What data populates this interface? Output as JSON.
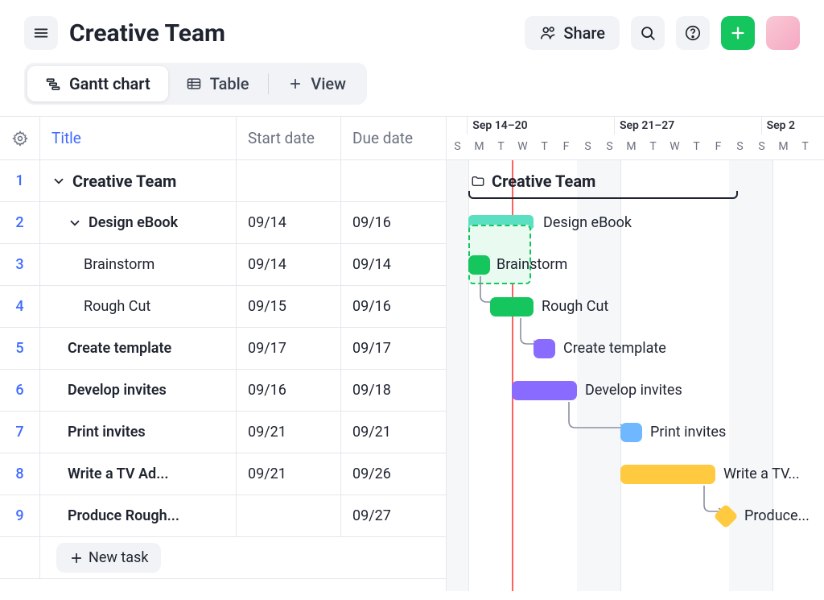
{
  "header": {
    "page_title": "Creative Team",
    "share_label": "Share"
  },
  "tabs": {
    "gantt_label": "Gantt chart",
    "table_label": "Table",
    "view_label": "View"
  },
  "columns": {
    "title": "Title",
    "start": "Start date",
    "due": "Due date"
  },
  "new_task_label": "New task",
  "weeks": [
    {
      "label": "Sep 14–20"
    },
    {
      "label": "Sep 21–27"
    },
    {
      "label": "Sep 2"
    }
  ],
  "day_letters": [
    "S",
    "M",
    "T",
    "W",
    "T",
    "F",
    "S",
    "S",
    "M",
    "T",
    "W",
    "T",
    "F",
    "S",
    "S",
    "M",
    "T"
  ],
  "group_label": "Creative Team",
  "rows": [
    {
      "num": "1",
      "title": "Creative Team",
      "start": "",
      "due": "",
      "indent": 0,
      "chevron": true
    },
    {
      "num": "2",
      "title": "Design eBook",
      "start": "09/14",
      "due": "09/16",
      "indent": 1,
      "chevron": true
    },
    {
      "num": "3",
      "title": "Brainstorm",
      "start": "09/14",
      "due": "09/14",
      "indent": 2
    },
    {
      "num": "4",
      "title": "Rough Cut",
      "start": "09/15",
      "due": "09/16",
      "indent": 2
    },
    {
      "num": "5",
      "title": "Create template",
      "start": "09/17",
      "due": "09/17",
      "indent": 1
    },
    {
      "num": "6",
      "title": "Develop invites",
      "start": "09/16",
      "due": "09/18",
      "indent": 1
    },
    {
      "num": "7",
      "title": "Print invites",
      "start": "09/21",
      "due": "09/21",
      "indent": 1
    },
    {
      "num": "8",
      "title": "Write a TV Ad...",
      "start": "09/21",
      "due": "09/26",
      "indent": 1
    },
    {
      "num": "9",
      "title": "Produce Rough...",
      "start": "",
      "due": "09/27",
      "indent": 1
    }
  ],
  "gantt": {
    "bars": {
      "design_ebook": "Design eBook",
      "brainstorm": "Brainstorm",
      "rough_cut": "Rough Cut",
      "create_template": "Create template",
      "develop_invites": "Develop invites",
      "print_invites": "Print invites",
      "write_tv": "Write a TV...",
      "produce": "Produce..."
    }
  },
  "colors": {
    "green": "#15c65f",
    "teal": "#5ae0c1",
    "purple": "#8a6bff",
    "blue": "#6fb8ff",
    "yellow": "#ffc940"
  },
  "chart_data": {
    "type": "gantt",
    "date_range": {
      "start": "09/13",
      "visible_end": "09/29"
    },
    "today": "09/15",
    "group": "Creative Team",
    "group_span": {
      "start": "09/14",
      "end": "09/26"
    },
    "tasks": [
      {
        "name": "Design eBook",
        "start": "09/14",
        "end": "09/16",
        "type": "summary",
        "color": "#5ae0c1"
      },
      {
        "name": "Brainstorm",
        "start": "09/14",
        "end": "09/14",
        "color": "#15c65f",
        "planned_end": "09/16"
      },
      {
        "name": "Rough Cut",
        "start": "09/15",
        "end": "09/16",
        "color": "#15c65f"
      },
      {
        "name": "Create template",
        "start": "09/17",
        "end": "09/17",
        "color": "#8a6bff"
      },
      {
        "name": "Develop invites",
        "start": "09/16",
        "end": "09/18",
        "color": "#8a6bff"
      },
      {
        "name": "Print invites",
        "start": "09/21",
        "end": "09/21",
        "color": "#6fb8ff"
      },
      {
        "name": "Write a TV Ad",
        "start": "09/21",
        "end": "09/26",
        "color": "#ffc940"
      },
      {
        "name": "Produce Rough",
        "end": "09/27",
        "type": "milestone",
        "color": "#ffc940"
      }
    ],
    "dependencies": [
      [
        "Brainstorm",
        "Rough Cut"
      ],
      [
        "Rough Cut",
        "Create template"
      ],
      [
        "Develop invites",
        "Print invites"
      ],
      [
        "Write a TV Ad",
        "Produce Rough"
      ]
    ]
  }
}
